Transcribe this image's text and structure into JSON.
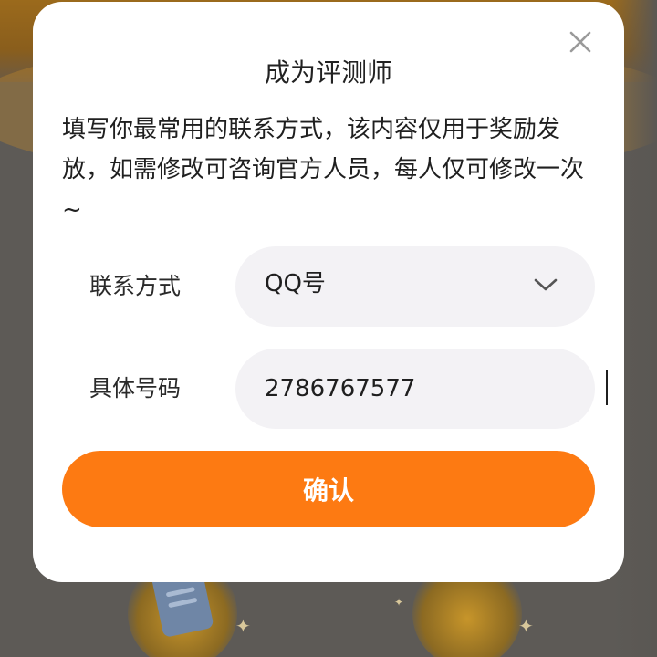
{
  "dialog": {
    "title": "成为评测师",
    "description": "填写你最常用的联系方式，该内容仅用于奖励发放，如需修改可咨询官方人员，每人仅可修改一次~",
    "close_icon": "close-icon"
  },
  "form": {
    "contact_method": {
      "label": "联系方式",
      "value": "QQ号",
      "icon": "chevron-down-icon"
    },
    "contact_number": {
      "label": "具体号码",
      "value": "2786767577"
    }
  },
  "actions": {
    "confirm_label": "确认"
  },
  "colors": {
    "accent": "#fd7a12",
    "field_background": "#f3f2f5",
    "overlay": "#5d5a56"
  }
}
